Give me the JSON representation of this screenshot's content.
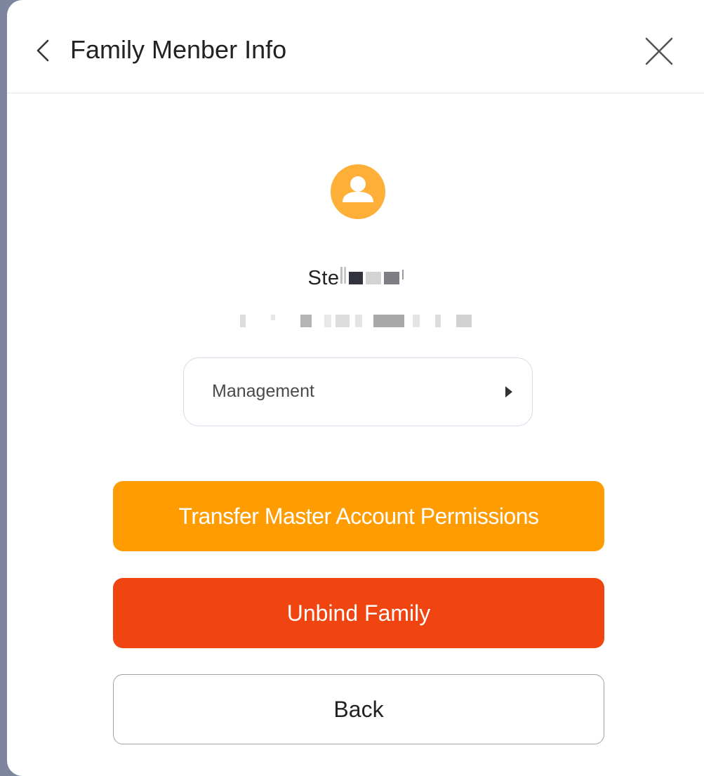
{
  "header": {
    "title": "Family Menber Info",
    "back_icon": "chevron-left-icon",
    "close_icon": "close-icon"
  },
  "member": {
    "avatar_icon": "user-avatar-icon",
    "avatar_color": "#FDA92C",
    "name_visible": "Ste",
    "email_visible": ""
  },
  "management": {
    "label": "Management",
    "arrow_icon": "caret-right-icon"
  },
  "buttons": {
    "transfer_label": "Transfer Master Account Permissions",
    "unbind_label": "Unbind Family",
    "back_label": "Back"
  },
  "colors": {
    "transfer": "#FE9C02",
    "unbind": "#F04411",
    "backdrop": "#7D869E"
  }
}
